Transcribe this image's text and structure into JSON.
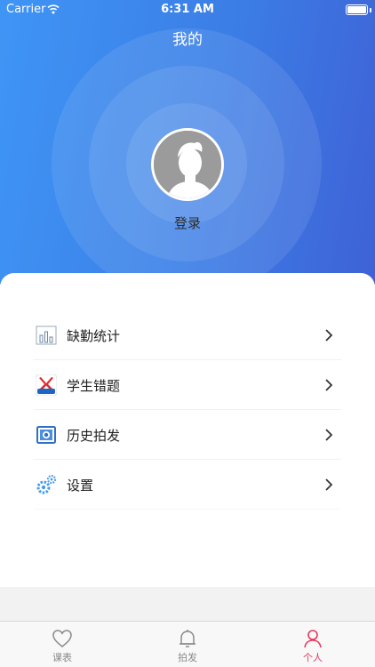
{
  "status_bar": {
    "carrier": "Carrier",
    "time": "6:31 AM"
  },
  "nav": {
    "title": "我的"
  },
  "profile": {
    "login_label": "登录"
  },
  "menu": {
    "items": [
      {
        "label": "缺勤统计",
        "icon": "bar-chart-icon"
      },
      {
        "label": "学生错题",
        "icon": "wrong-questions-logo-icon"
      },
      {
        "label": "历史拍发",
        "icon": "photo-history-icon"
      },
      {
        "label": "设置",
        "icon": "gears-icon"
      }
    ]
  },
  "tabbar": {
    "tabs": [
      {
        "label": "课表",
        "icon": "heart-icon"
      },
      {
        "label": "拍发",
        "icon": "bell-icon"
      },
      {
        "label": "个人",
        "icon": "person-icon",
        "active": true
      }
    ]
  },
  "colors": {
    "header_start": "#3f95f5",
    "header_end": "#3f62d6",
    "accent_active": "#e8385a"
  }
}
